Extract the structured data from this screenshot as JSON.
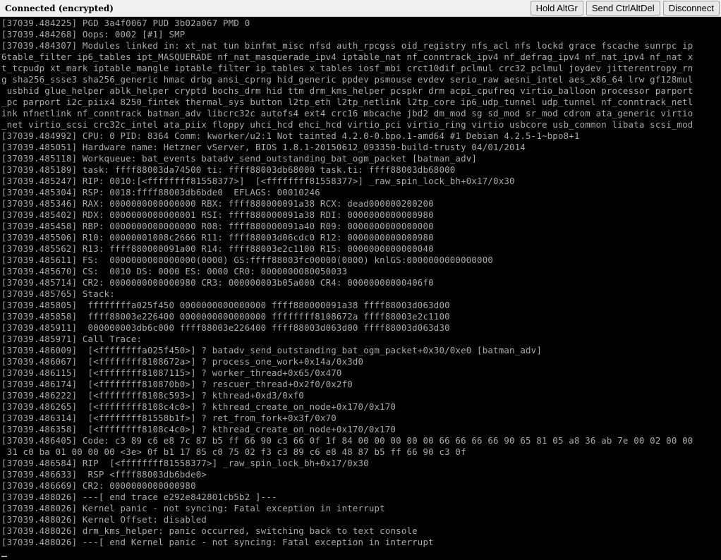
{
  "toolbar": {
    "status": "Connected (encrypted)",
    "hold_altgr": "Hold AltGr",
    "send_ctrlaltdel": "Send CtrlAltDel",
    "disconnect": "Disconnect"
  },
  "console": {
    "lines": [
      "[37039.484225] PGD 3a4f0067 PUD 3b02a067 PMD 0",
      "[37039.484268] Oops: 0002 [#1] SMP",
      "[37039.484307] Modules linked in: xt_nat tun binfmt_misc nfsd auth_rpcgss oid_registry nfs_acl nfs lockd grace fscache sunrpc ip",
      "6table_filter ip6_tables ipt_MASQUERADE nf_nat_masquerade_ipv4 iptable_nat nf_conntrack_ipv4 nf_defrag_ipv4 nf_nat_ipv4 nf_nat x",
      "t_tcpudp xt_mark iptable_mangle iptable_filter ip_tables x_tables iosf_mbi crct10dif_pclmul crc32_pclmul joydev jitterentropy_rn",
      "g sha256_ssse3 sha256_generic hmac drbg ansi_cprng hid_generic ppdev psmouse evdev serio_raw aesni_intel aes_x86_64 lrw gf128mul",
      " usbhid glue_helper ablk_helper cryptd bochs_drm hid ttm drm_kms_helper pcspkr drm acpi_cpufreq virtio_balloon processor parport",
      "_pc parport i2c_piix4 8250_fintek thermal_sys button l2tp_eth l2tp_netlink l2tp_core ip6_udp_tunnel udp_tunnel nf_conntrack_netl",
      "ink nfnetlink nf_conntrack batman_adv libcrc32c autofs4 ext4 crc16 mbcache jbd2 dm_mod sg sd_mod sr_mod cdrom ata_generic virtio",
      "_net virtio_scsi crc32c_intel ata_piix floppy uhci_hcd ehci_hcd virtio_pci virtio_ring virtio usbcore usb_common libata scsi_mod",
      "[37039.484992] CPU: 0 PID: 8364 Comm: kworker/u2:1 Not tainted 4.2.0-0.bpo.1-amd64 #1 Debian 4.2.5-1~bpo8+1",
      "[37039.485051] Hardware name: Hetzner vServer, BIOS 1.8.1-20150612_093350-build-trusty 04/01/2014",
      "[37039.485118] Workqueue: bat_events batadv_send_outstanding_bat_ogm_packet [batman_adv]",
      "[37039.485189] task: ffff88003da74500 ti: ffff88003db68000 task.ti: ffff88003db68000",
      "[37039.485247] RIP: 0010:[<ffffffff81558377>]  [<ffffffff81558377>] _raw_spin_lock_bh+0x17/0x30",
      "[37039.485304] RSP: 0018:ffff88003db6bde0  EFLAGS: 00010246",
      "[37039.485346] RAX: 0000000000000000 RBX: ffff880000091a38 RCX: dead000000200200",
      "[37039.485402] RDX: 0000000000000001 RSI: ffff880000091a38 RDI: 0000000000000980",
      "[37039.485458] RBP: 0000000000000000 R08: ffff880000091a40 R09: 0000000000000000",
      "[37039.485506] R10: 00000001008c2666 R11: ffff88003d06cdc0 R12: 0000000000000980",
      "[37039.485562] R13: ffff880000091a00 R14: ffff88003e2c1100 R15: 0000000000000040",
      "[37039.485611] FS:  0000000000000000(0000) GS:ffff88003fc00000(0000) knlGS:0000000000000000",
      "[37039.485670] CS:  0010 DS: 0000 ES: 0000 CR0: 0000000080050033",
      "[37039.485714] CR2: 0000000000000980 CR3: 000000003b05a000 CR4: 00000000000406f0",
      "[37039.485765] Stack:",
      "[37039.485805]  ffffffffa025f450 0000000000000000 ffff880000091a38 ffff88003d063d00",
      "[37039.485858]  ffff88003e226400 0000000000000000 ffffffff8108672a ffff88003e2c1100",
      "[37039.485911]  000000003db6c000 ffff88003e226400 ffff88003d063d00 ffff88003d063d30",
      "[37039.485971] Call Trace:",
      "[37039.486009]  [<ffffffffa025f450>] ? batadv_send_outstanding_bat_ogm_packet+0x30/0xe0 [batman_adv]",
      "[37039.486067]  [<ffffffff8108672a>] ? process_one_work+0x14a/0x3d0",
      "[37039.486115]  [<ffffffff81087115>] ? worker_thread+0x65/0x470",
      "[37039.486174]  [<ffffffff810870b0>] ? rescuer_thread+0x2f0/0x2f0",
      "[37039.486222]  [<ffffffff8108c593>] ? kthread+0xd3/0xf0",
      "[37039.486265]  [<ffffffff8108c4c0>] ? kthread_create_on_node+0x170/0x170",
      "[37039.486314]  [<ffffffff81558b1f>] ? ret_from_fork+0x3f/0x70",
      "[37039.486358]  [<ffffffff8108c4c0>] ? kthread_create_on_node+0x170/0x170",
      "[37039.486405] Code: c3 89 c6 e8 7c 87 b5 ff 66 90 c3 66 0f 1f 84 00 00 00 00 00 66 66 66 66 90 65 81 05 a8 36 ab 7e 00 02 00 00",
      " 31 c0 ba 01 00 00 00 <3e> 0f b1 17 85 c0 75 02 f3 c3 89 c6 e8 48 87 b5 ff 66 90 c3 0f",
      "[37039.486584] RIP  [<ffffffff81558377>] _raw_spin_lock_bh+0x17/0x30",
      "[37039.486633]  RSP <ffff88003db6bde0>",
      "[37039.486669] CR2: 0000000000000980",
      "[37039.488026] ---[ end trace e292e842801cb5b2 ]---",
      "[37039.488026] Kernel panic - not syncing: Fatal exception in interrupt",
      "[37039.488026] Kernel Offset: disabled",
      "[37039.488026] drm_kms_helper: panic occurred, switching back to text console",
      "[37039.488026] ---[ end Kernel panic - not syncing: Fatal exception in interrupt"
    ]
  }
}
